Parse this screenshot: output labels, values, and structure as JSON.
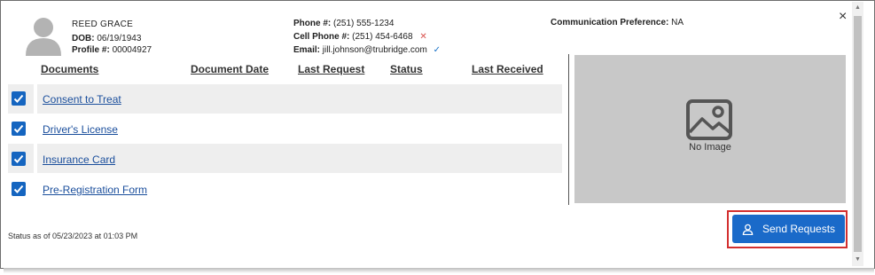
{
  "patient": {
    "name": "REED  GRACE",
    "dob_label": "DOB:",
    "dob": "06/19/1943",
    "profile_label": "Profile #:",
    "profile": "00004927"
  },
  "contact": {
    "phone_label": "Phone #:",
    "phone": "(251) 555-1234",
    "cell_label": "Cell Phone #:",
    "cell": "(251) 454-6468",
    "cell_status_glyph": "✕",
    "email_label": "Email:",
    "email": "jill.johnson@trubridge.com",
    "email_status_glyph": "✓"
  },
  "communication": {
    "label": "Communication Preference:",
    "value": "NA"
  },
  "close_glyph": "×",
  "columns": [
    "Documents",
    "Document Date",
    "Last Request",
    "Status",
    "Last Received"
  ],
  "documents": [
    {
      "name": "Consent to Treat",
      "checked": true
    },
    {
      "name": "Driver's License",
      "checked": true
    },
    {
      "name": "Insurance Card",
      "checked": true
    },
    {
      "name": "Pre-Registration Form",
      "checked": true
    }
  ],
  "preview": {
    "no_image_text": "No Image",
    "icon": "image-placeholder-icon"
  },
  "status_text": "Status as of 05/23/2023 at 01:03 PM",
  "send_button": {
    "label": "Send Requests",
    "icon": "person-icon",
    "color": "#1a6ac9"
  },
  "highlight_color": "#d32f2f"
}
